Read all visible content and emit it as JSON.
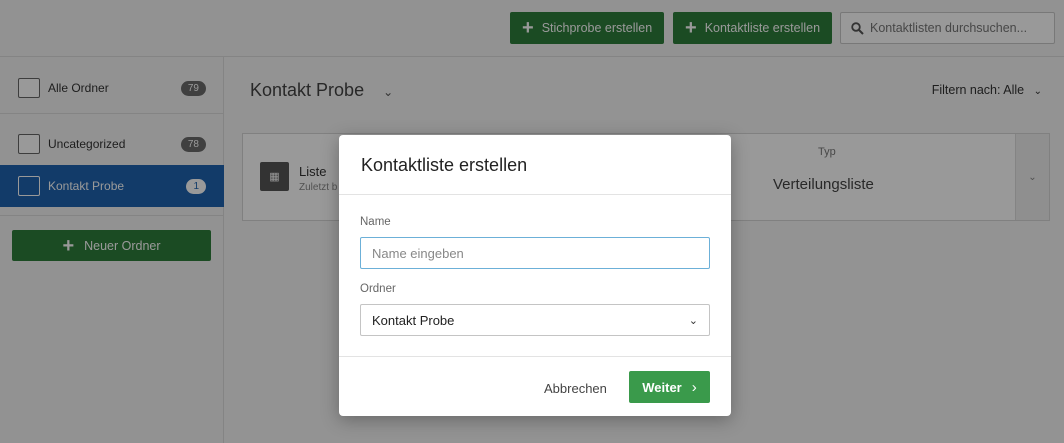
{
  "topbar": {
    "sample_button": "Stichprobe erstellen",
    "contact_list_button": "Kontaktliste erstellen",
    "search_placeholder": "Kontaktlisten durchsuchen..."
  },
  "sidebar": {
    "items": [
      {
        "label": "Alle Ordner",
        "count": "79"
      },
      {
        "label": "Uncategorized",
        "count": "78"
      },
      {
        "label": "Kontakt Probe",
        "count": "1"
      }
    ],
    "new_folder_button": "Neuer Ordner"
  },
  "main": {
    "title": "Kontakt Probe",
    "filter": "Filtern nach: Alle",
    "card": {
      "title": "Liste",
      "subtitle": "Zuletzt b",
      "type_label": "Typ",
      "type_value": "Verteilungsliste"
    }
  },
  "modal": {
    "title": "Kontaktliste erstellen",
    "name_label": "Name",
    "name_placeholder": "Name eingeben",
    "folder_label": "Ordner",
    "folder_value": "Kontakt Probe",
    "cancel_button": "Abbrechen",
    "next_button": "Weiter"
  },
  "colors": {
    "primary_green": "#2e7d3b",
    "next_green": "#3a9a4b",
    "active_blue": "#1e63b0"
  }
}
